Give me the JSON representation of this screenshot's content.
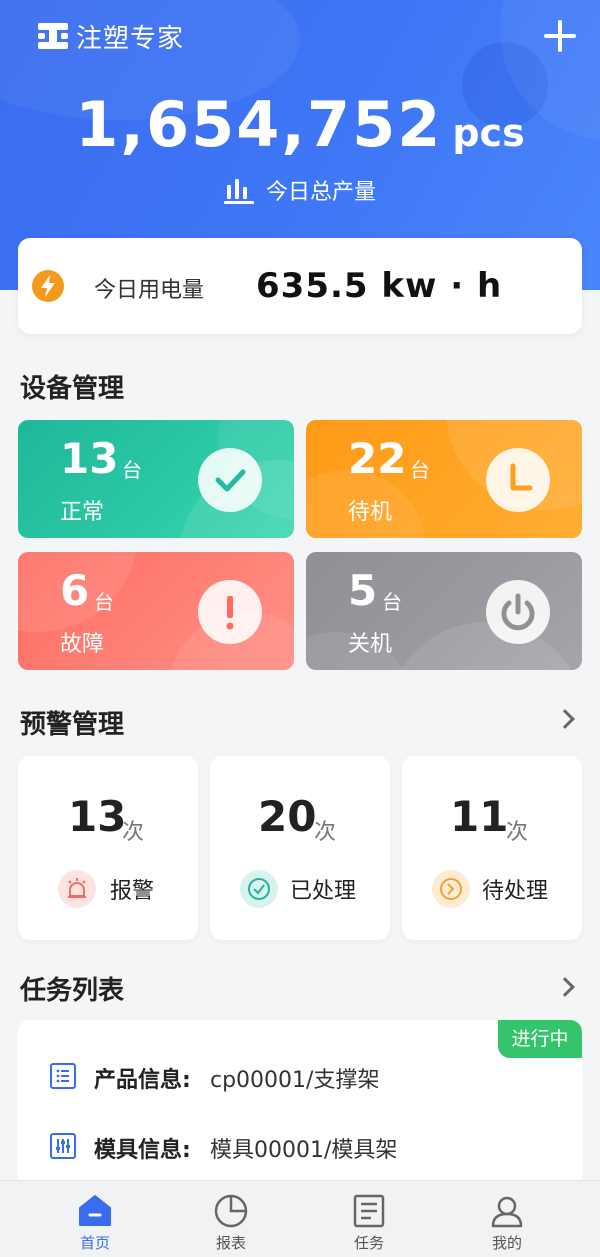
{
  "header": {
    "app_title": "注塑专家",
    "production_total": "1,654,752",
    "production_unit": "pcs",
    "production_label": "今日总产量",
    "colors": {
      "primary": "#3a6cf0"
    }
  },
  "power": {
    "label": "今日用电量",
    "value": "635.5 kw · h",
    "icon": "lightning-icon"
  },
  "device_section": {
    "title": "设备管理",
    "cards": [
      {
        "count": "13",
        "unit": "台",
        "label": "正常",
        "icon": "check-icon",
        "color": "#1fb79a"
      },
      {
        "count": "22",
        "unit": "台",
        "label": "待机",
        "icon": "clock-icon",
        "color": "#ff9a16"
      },
      {
        "count": "6",
        "unit": "台",
        "label": "故障",
        "icon": "exclamation-icon",
        "color": "#ff6c61"
      },
      {
        "count": "5",
        "unit": "台",
        "label": "关机",
        "icon": "power-icon",
        "color": "#8f9095"
      }
    ]
  },
  "warning_section": {
    "title": "预警管理",
    "cards": [
      {
        "count": "13",
        "unit": "次",
        "label": "报警",
        "icon": "alarm-icon",
        "color": "#f26d62"
      },
      {
        "count": "20",
        "unit": "次",
        "label": "已处理",
        "icon": "check-circle-icon",
        "color": "#20b49a"
      },
      {
        "count": "11",
        "unit": "次",
        "label": "待处理",
        "icon": "arrow-circle-icon",
        "color": "#f5a13b"
      }
    ]
  },
  "task_section": {
    "title": "任务列表",
    "badge": "进行中",
    "rows": [
      {
        "key": "产品信息:",
        "value": "cp00001/支撑架",
        "icon": "list-icon"
      },
      {
        "key": "模具信息:",
        "value": "模具00001/模具架",
        "icon": "sliders-icon"
      }
    ]
  },
  "tabbar": {
    "tabs": [
      {
        "label": "首页",
        "icon": "home-icon",
        "active": true
      },
      {
        "label": "报表",
        "icon": "pie-chart-icon",
        "active": false
      },
      {
        "label": "任务",
        "icon": "document-icon",
        "active": false
      },
      {
        "label": "我的",
        "icon": "user-icon",
        "active": false
      }
    ]
  }
}
